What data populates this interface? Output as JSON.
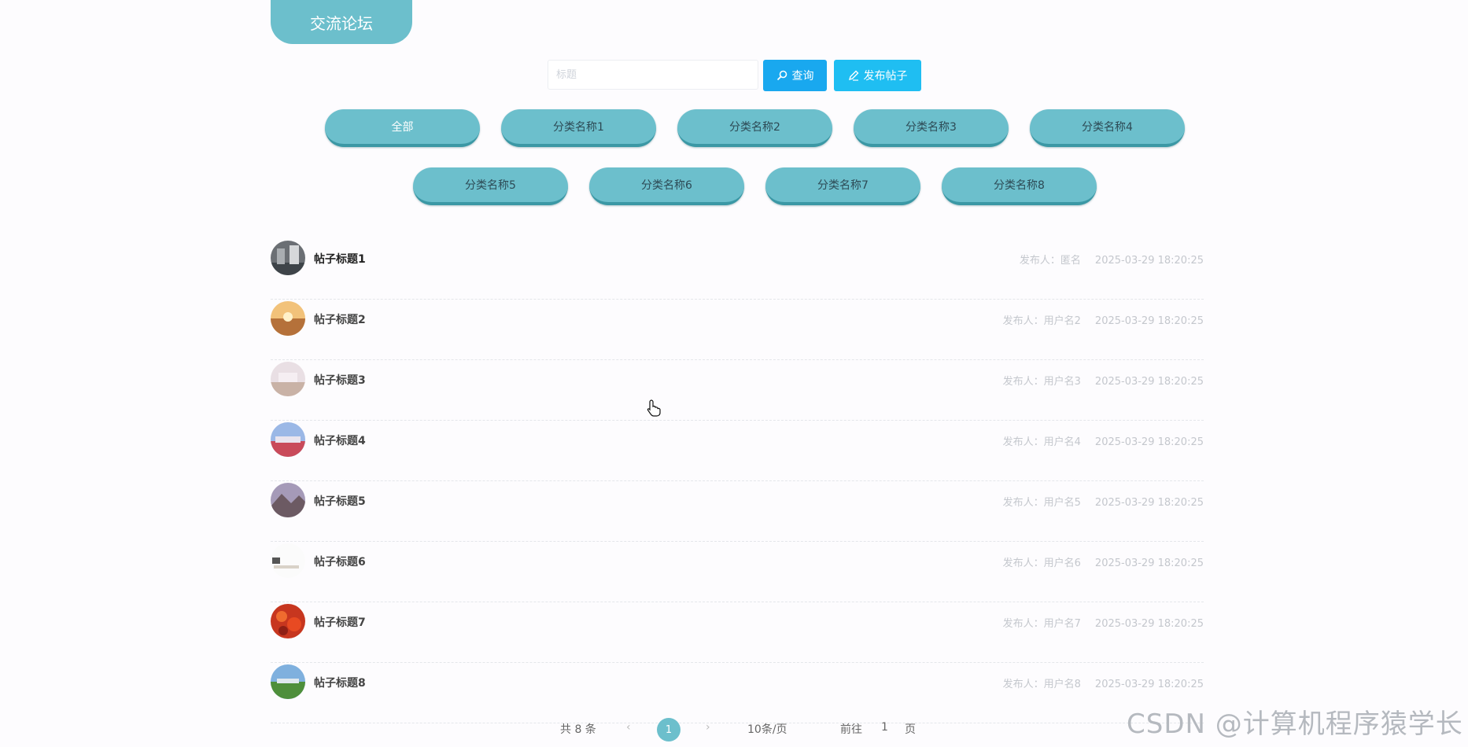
{
  "header": {
    "title": "交流论坛"
  },
  "search": {
    "placeholder": "标题",
    "value": "",
    "query_label": "查询",
    "publish_label": "发布帖子"
  },
  "categories": {
    "row1": [
      "全部",
      "分类名称1",
      "分类名称2",
      "分类名称3",
      "分类名称4"
    ],
    "row2": [
      "分类名称5",
      "分类名称6",
      "分类名称7",
      "分类名称8"
    ],
    "active": "全部"
  },
  "posts": [
    {
      "title": "帖子标题1",
      "author": "发布人：匿名",
      "time": "2025-03-29 18:20:25"
    },
    {
      "title": "帖子标题2",
      "author": "发布人：用户名2",
      "time": "2025-03-29 18:20:25"
    },
    {
      "title": "帖子标题3",
      "author": "发布人：用户名3",
      "time": "2025-03-29 18:20:25"
    },
    {
      "title": "帖子标题4",
      "author": "发布人：用户名4",
      "time": "2025-03-29 18:20:25"
    },
    {
      "title": "帖子标题5",
      "author": "发布人：用户名5",
      "time": "2025-03-29 18:20:25"
    },
    {
      "title": "帖子标题6",
      "author": "发布人：用户名6",
      "time": "2025-03-29 18:20:25"
    },
    {
      "title": "帖子标题7",
      "author": "发布人：用户名7",
      "time": "2025-03-29 18:20:25"
    },
    {
      "title": "帖子标题8",
      "author": "发布人：用户名8",
      "time": "2025-03-29 18:20:25"
    }
  ],
  "pagination": {
    "total": "共 8 条",
    "prev": "‹",
    "current": "1",
    "next": "›",
    "page_size": "10条/页",
    "goto_label": "前往",
    "goto_value": "1",
    "page_unit": "页"
  },
  "watermark": "CSDN @计算机程序猿学长",
  "colors": {
    "accent": "#6cbfcc",
    "query": "#19a8ef",
    "publish": "#1fbef2"
  },
  "icons": {
    "query": "search-icon",
    "publish": "edit-icon"
  }
}
